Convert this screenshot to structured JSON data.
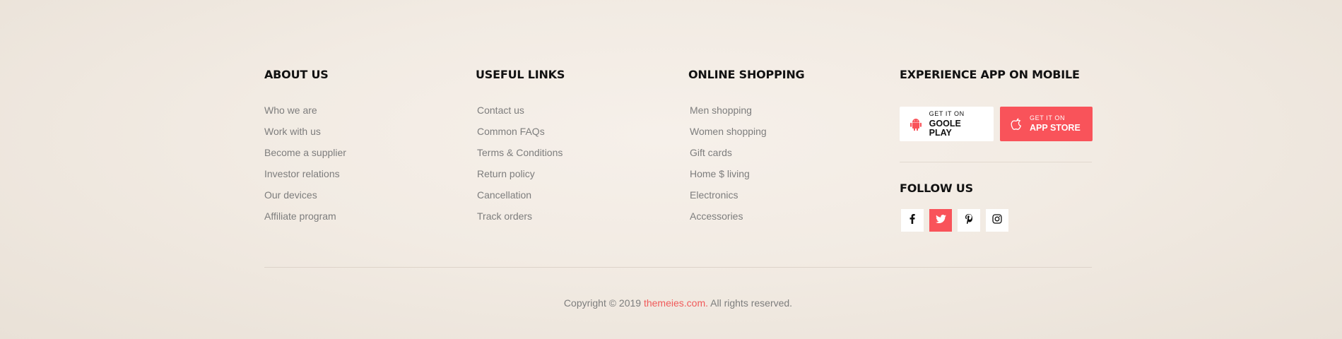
{
  "columns": {
    "about": {
      "heading": "ABOUT US",
      "links": [
        "Who we are",
        "Work with us",
        "Become a supplier",
        "Investor relations",
        "Our devices",
        "Affiliate program"
      ]
    },
    "useful": {
      "heading": "USEFUL LINKS",
      "links": [
        "Contact us",
        "Common FAQs",
        "Terms & Conditions",
        "Return policy",
        "Cancellation",
        "Track orders"
      ]
    },
    "shopping": {
      "heading": "ONLINE SHOPPING",
      "links": [
        "Men shopping",
        "Women shopping",
        "Gift cards",
        "Home $ living",
        "Electronics",
        "Accessories"
      ]
    }
  },
  "mobile": {
    "heading": "EXPERIENCE APP ON MOBILE",
    "google": {
      "small": "GET IT ON",
      "big": "GOOLE PLAY",
      "icon": "android-icon"
    },
    "apple": {
      "small": "GET IT ON",
      "big": "APP STORE",
      "icon": "apple-icon"
    }
  },
  "follow": {
    "heading": "FOLLOW US",
    "networks": [
      {
        "icon": "facebook-icon",
        "active": false
      },
      {
        "icon": "twitter-icon",
        "active": true
      },
      {
        "icon": "pinterest-icon",
        "active": false
      },
      {
        "icon": "instagram-icon",
        "active": false
      }
    ]
  },
  "copyright": {
    "prefix": "Copyright © 2019 ",
    "link": "themeies.com.",
    "suffix": " All rights reserved."
  },
  "colors": {
    "accent": "#f9535a",
    "link_text": "#7d7d7d",
    "heading": "#111111"
  }
}
